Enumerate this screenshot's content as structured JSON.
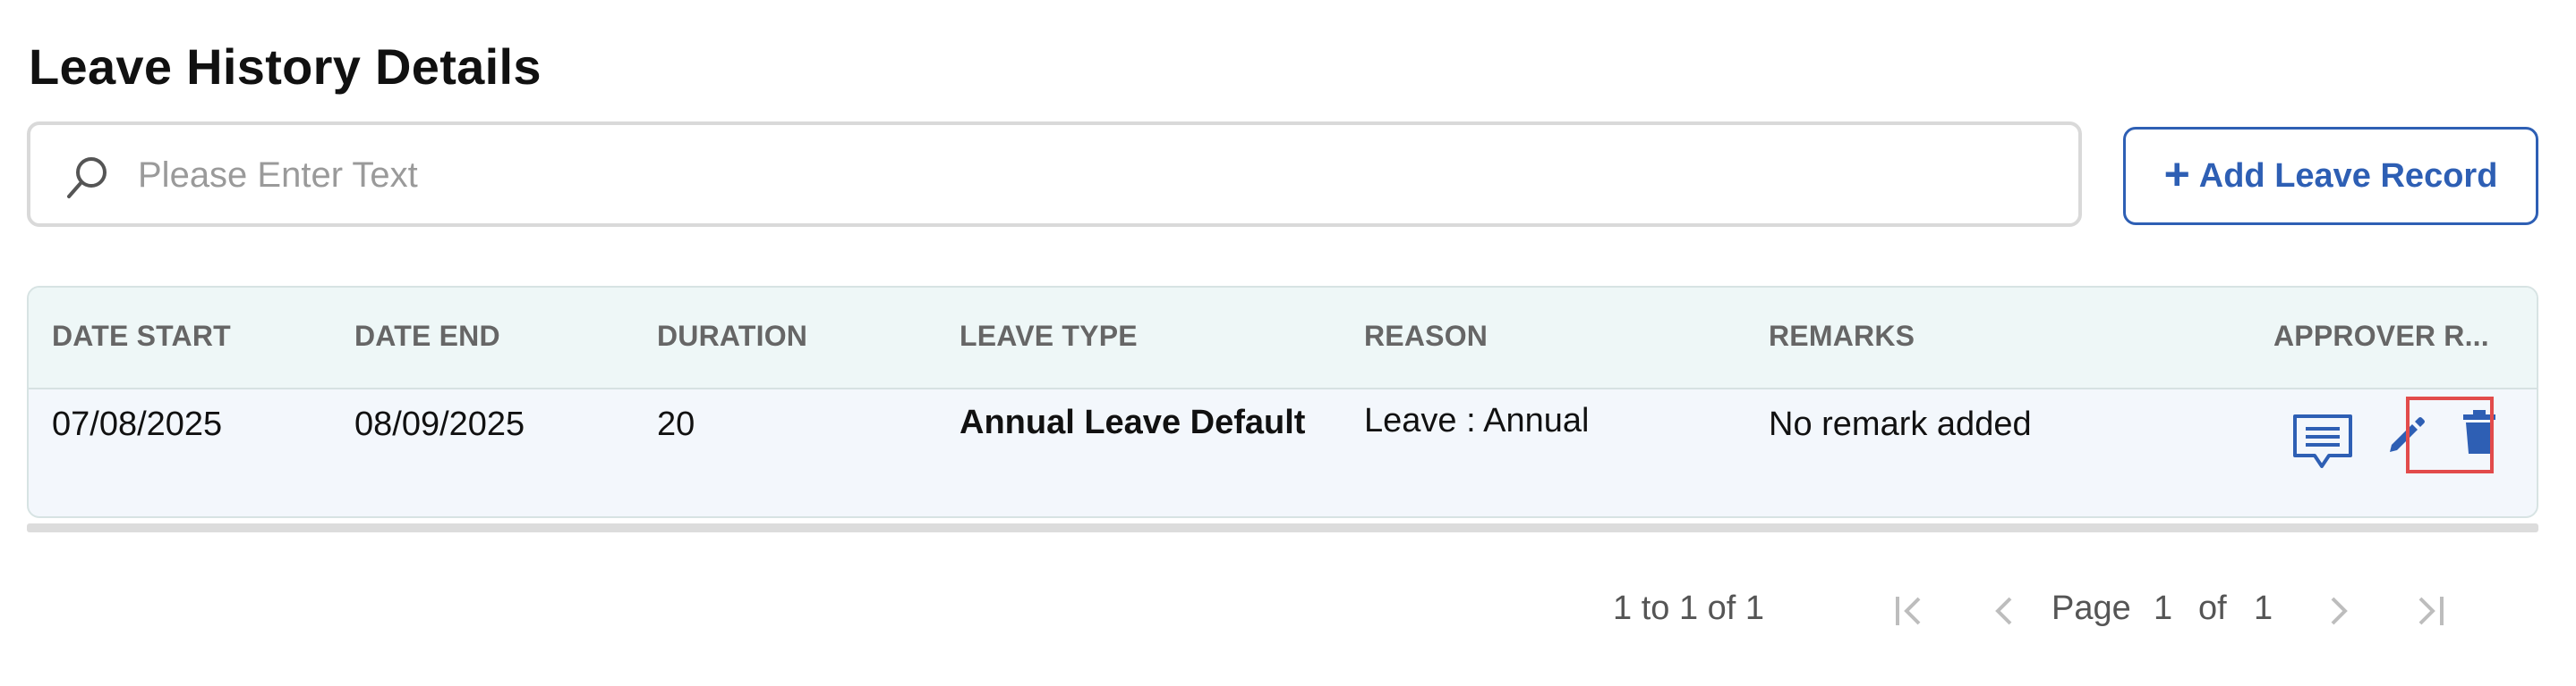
{
  "page_title": "Leave History Details",
  "search": {
    "placeholder": "Please Enter Text",
    "icon": "search-icon"
  },
  "add_button": {
    "label": "Add Leave Record",
    "icon": "plus-icon"
  },
  "table": {
    "columns": [
      "DATE START",
      "DATE END",
      "DURATION",
      "LEAVE TYPE",
      "REASON",
      "REMARKS",
      "APPROVER R..."
    ],
    "rows": [
      {
        "date_start": "07/08/2025",
        "date_end": "08/09/2025",
        "duration": "20",
        "leave_type": "Annual Leave Default",
        "reason": "Leave : Annual",
        "remarks": "No remark added"
      }
    ],
    "row_actions": [
      "comment-icon",
      "edit-icon",
      "delete-icon"
    ]
  },
  "pagination": {
    "range_text": "1 to 1 of 1",
    "page_label": "Page",
    "current_page": "1",
    "of_label": "of",
    "total_pages": "1"
  },
  "colors": {
    "accent": "#2e5fb4",
    "header_bg": "#eef7f7",
    "row_bg": "#f3f7fc",
    "highlight": "#e24b4b",
    "muted_icon": "#bdbdbd"
  }
}
